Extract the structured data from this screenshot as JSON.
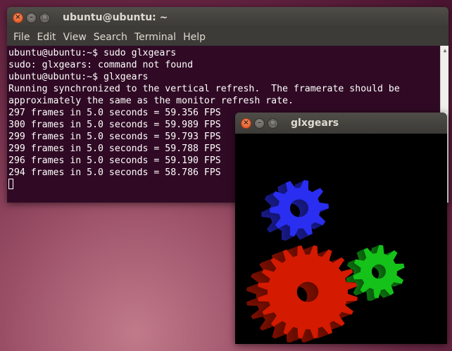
{
  "terminal": {
    "title": "ubuntu@ubuntu: ~",
    "menu": [
      "File",
      "Edit",
      "View",
      "Search",
      "Terminal",
      "Help"
    ],
    "lines": [
      "ubuntu@ubuntu:~$ sudo glxgears",
      "sudo: glxgears: command not found",
      "ubuntu@ubuntu:~$ glxgears",
      "Running synchronized to the vertical refresh.  The framerate should be",
      "approximately the same as the monitor refresh rate.",
      "297 frames in 5.0 seconds = 59.356 FPS",
      "300 frames in 5.0 seconds = 59.989 FPS",
      "299 frames in 5.0 seconds = 59.793 FPS",
      "299 frames in 5.0 seconds = 59.788 FPS",
      "296 frames in 5.0 seconds = 59.190 FPS",
      "294 frames in 5.0 seconds = 58.786 FPS"
    ],
    "background": "#300a24",
    "text_color": "#ffffff"
  },
  "glxgears": {
    "title": "glxgears",
    "gear_colors": {
      "red": "#d41a00",
      "green": "#15c21a",
      "blue": "#2a2ef0"
    }
  },
  "window_buttons": {
    "close_icon": "close-icon",
    "minimize_icon": "minimize-icon",
    "maximize_icon": "maximize-icon"
  }
}
